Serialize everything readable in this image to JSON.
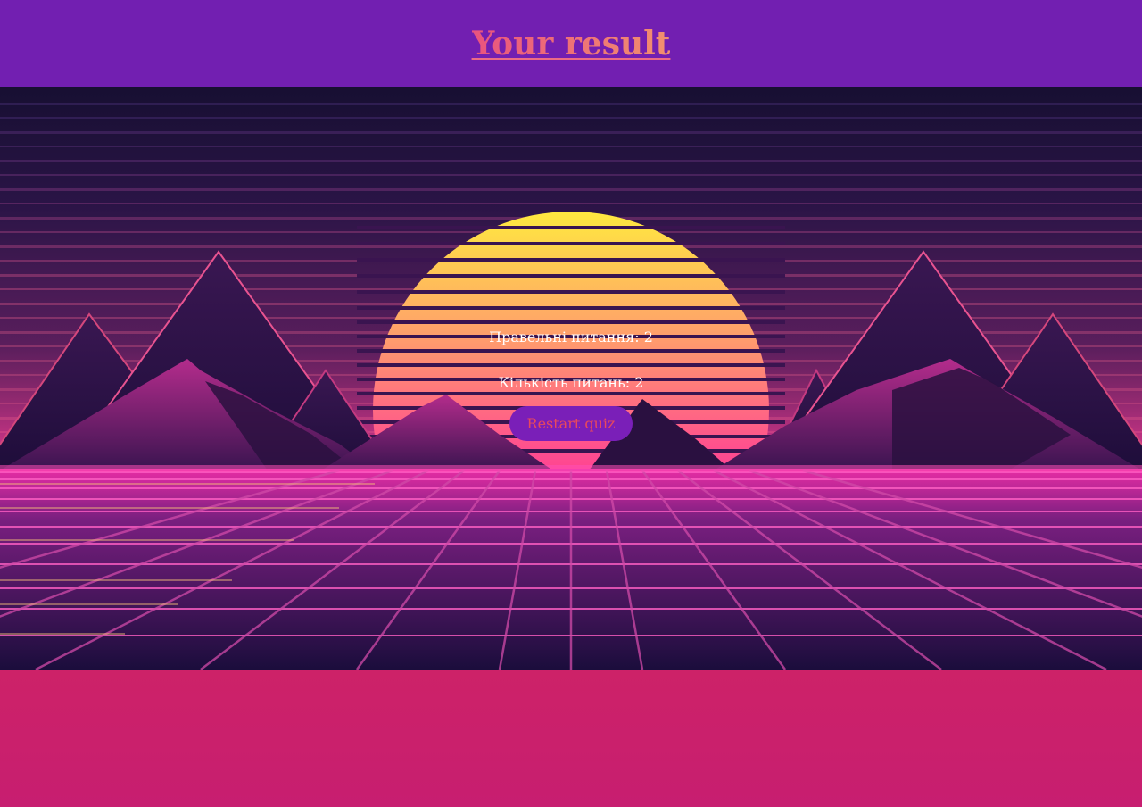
{
  "header": {
    "title": "Your result"
  },
  "result": {
    "correct_label": "Правельні питання: 2",
    "total_label": "Кількість питань: 2",
    "restart_label": "Restart quiz"
  },
  "colors": {
    "header_bg": "#721fb1",
    "title_gradient_start": "#e9537f",
    "title_gradient_end": "#f2906e",
    "button_bg": "#7a1fb8",
    "button_text": "#e8495c",
    "footer_top": "#e93d3f",
    "footer_bottom": "#c71e70"
  }
}
